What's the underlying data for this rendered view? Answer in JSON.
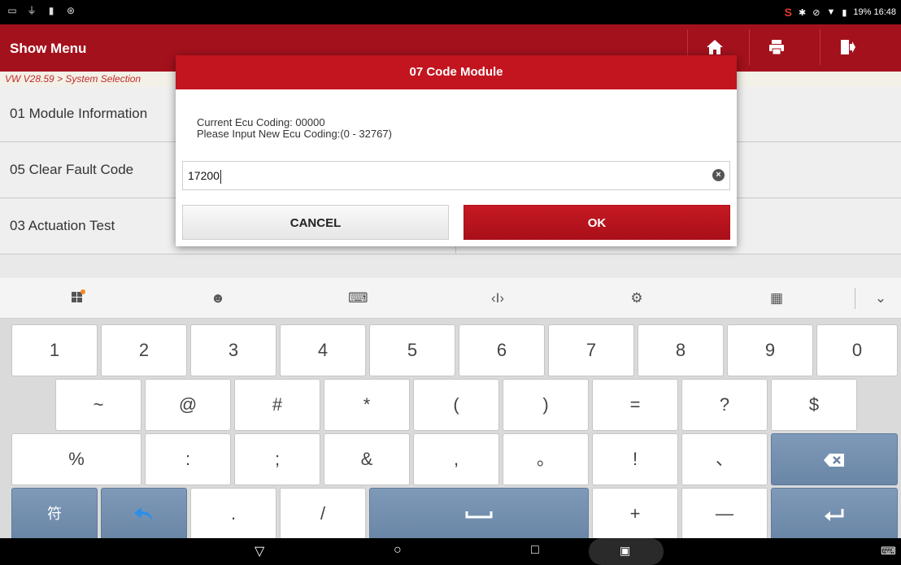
{
  "status_bar": {
    "left_icons": [
      "screen-icon",
      "usb-icon",
      "sd-icon",
      "sync-icon"
    ],
    "right_text": "19% 16:48",
    "icons": [
      "sogou-icon",
      "bluetooth-icon",
      "blocked-icon",
      "wifi-icon",
      "battery-icon"
    ]
  },
  "header": {
    "title": "Show Menu",
    "buttons": [
      "home-icon",
      "print-icon",
      "exit-icon"
    ]
  },
  "breadcrumb": "VW V28.59 > System Selection",
  "menu": {
    "items": [
      {
        "label": "01 Module Information"
      },
      {
        "label": "05 Clear Fault Code"
      },
      {
        "label": "03 Actuation Test"
      }
    ]
  },
  "dialog": {
    "title": "07 Code Module",
    "line1": "Current Ecu Coding: 00000",
    "line2": "Please Input New Ecu Coding:(0 - 32767)",
    "input_value": "17200",
    "cancel_label": "CANCEL",
    "ok_label": "OK"
  },
  "keyboard": {
    "toolbar": [
      "apps-icon",
      "emoji-icon",
      "keyboard-icon",
      "cursor-icon",
      "settings-icon",
      "layout-icon",
      "collapse-icon"
    ],
    "row1": [
      "1",
      "2",
      "3",
      "4",
      "5",
      "6",
      "7",
      "8",
      "9",
      "0"
    ],
    "row2": [
      "~",
      "@",
      "#",
      "*",
      "(",
      ")",
      "=",
      "?",
      "$"
    ],
    "row3": [
      "%",
      ":",
      ";",
      "&",
      ",",
      "。",
      "!",
      "、"
    ],
    "row4": {
      "symbol": "符",
      "dot": ".",
      "slash": "/",
      "plus": "+",
      "minus": "—"
    }
  },
  "colors": {
    "header": "#a3111c",
    "dialog_header": "#c3151f",
    "ok_button": "#b3121b",
    "special_key": "#7190b0"
  }
}
